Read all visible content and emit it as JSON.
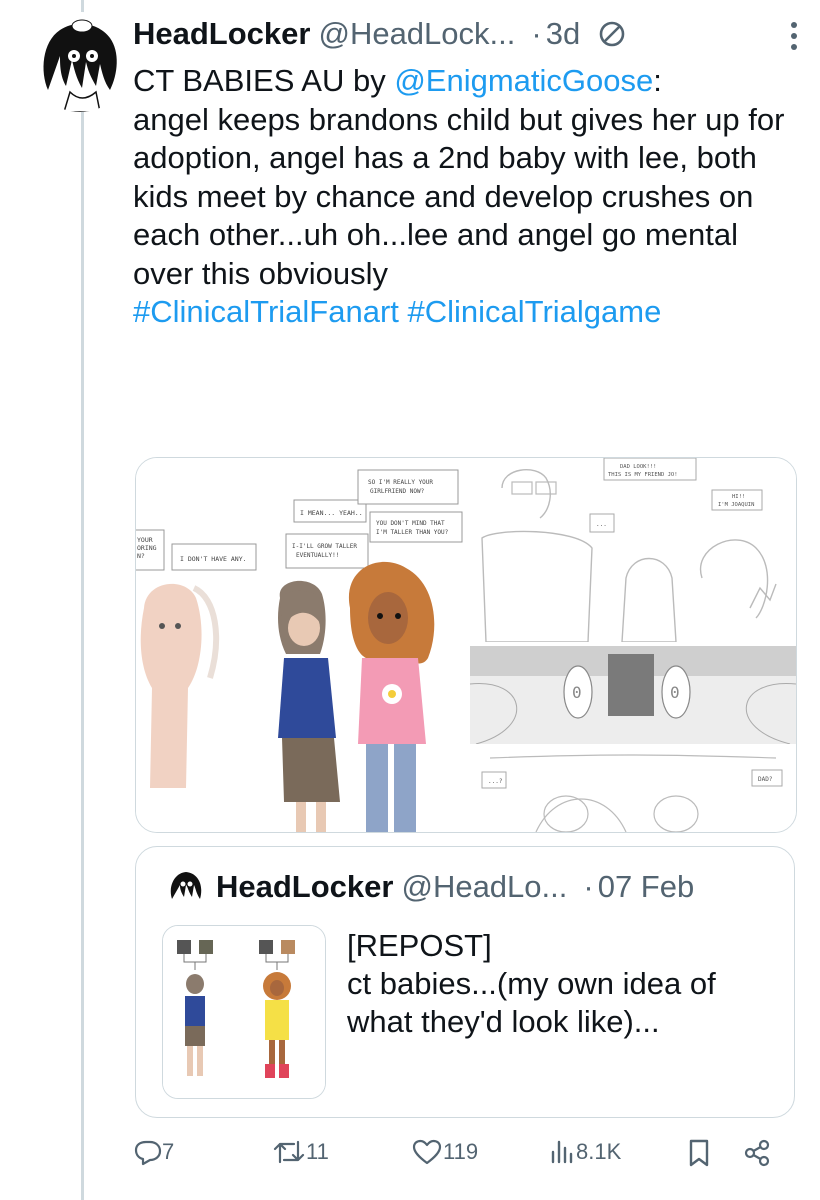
{
  "tweet": {
    "display_name": "HeadLocker",
    "handle": "@HeadLock...",
    "time": "3d",
    "text_prefix": "CT BABIES AU by ",
    "mention": "@EnigmaticGoose",
    "text_body": ":\nangel keeps brandons child but gives her up for adoption, angel has a 2nd baby with lee, both kids meet by chance and develop crushes on each other...uh oh...lee and angel go mental over this obviously\n",
    "hashtag1": "#ClinicalTrialFanart",
    "hashtag2": "#ClinicalTrialgame"
  },
  "comic": {
    "bubble1": "YOUR\nORING\nN?",
    "bubble2": "I DON'T HAVE ANY.",
    "bubble3": "I MEAN... YEAH..",
    "bubble4": "SO I'M REALLY YOUR\nGIRLFRIEND NOW?",
    "bubble5": "YOU DON'T MIND THAT\nI'M TALLER THAN YOU?",
    "bubble6": "I-I'LL GROW TALLER\nEVENTUALLY!!",
    "bubble7": "DAD LOOK!!!\nTHIS IS MY FRIEND JO!",
    "bubble8": "HI!!\nI'M JOAQUIN",
    "bubble9": "...",
    "bubble10": "...?",
    "bubble11": "DAD?"
  },
  "quote": {
    "display_name": "HeadLocker",
    "handle": "@HeadLo...",
    "time": "07 Feb",
    "text": "[REPOST]\nct babies...(my own idea of what they'd look like)..."
  },
  "actions": {
    "replies": "7",
    "reposts": "11",
    "likes": "119",
    "views": "8.1K"
  },
  "colors": {
    "link": "#1d9bf0",
    "secondary": "#536471",
    "border": "#cfd9de"
  }
}
